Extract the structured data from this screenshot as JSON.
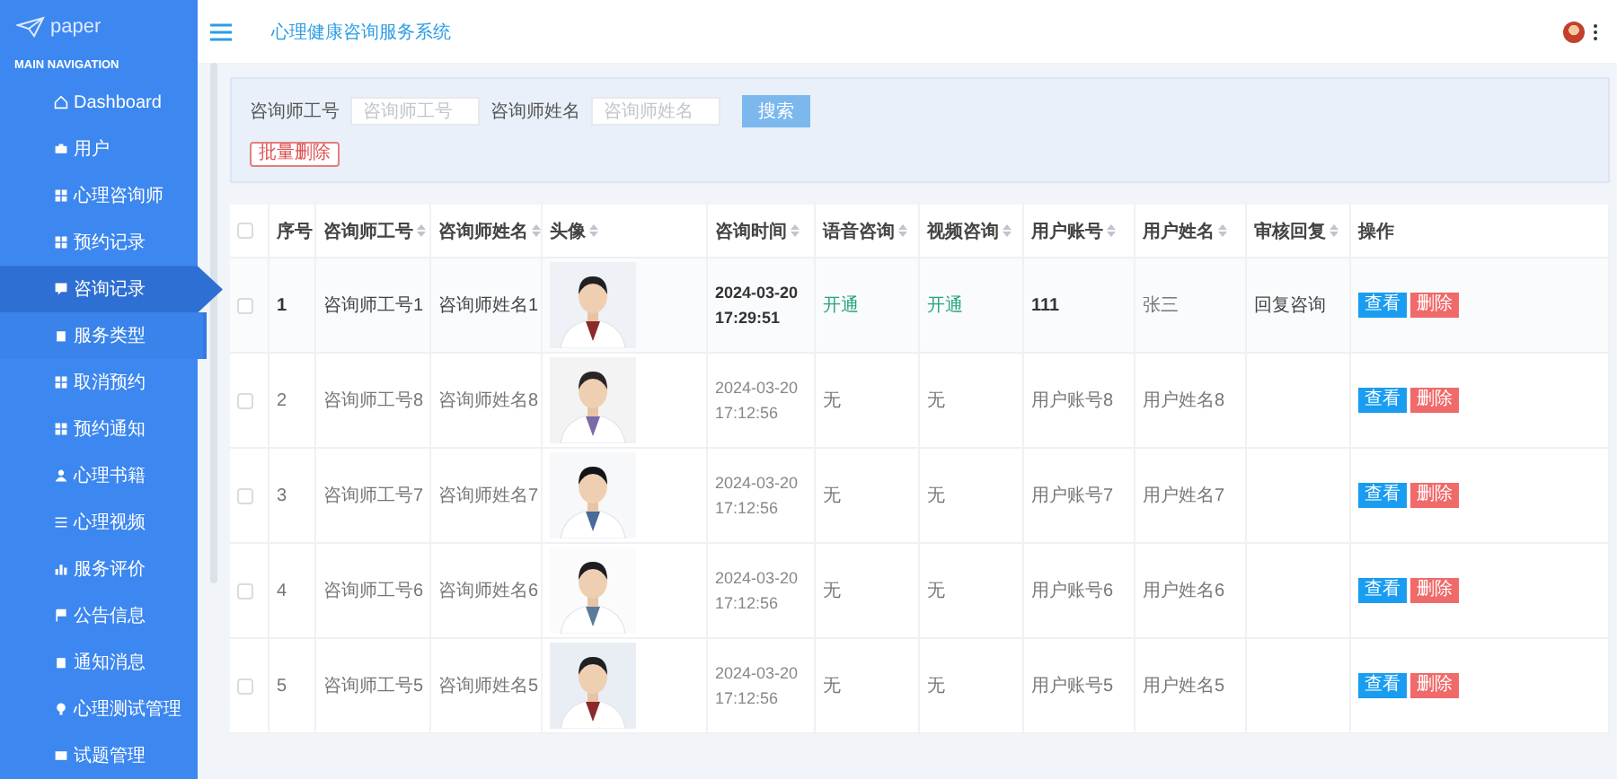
{
  "sidebar": {
    "logo": "paper",
    "section": "MAIN NAVIGATION",
    "items": [
      {
        "label": "Dashboard",
        "selected": false,
        "hovered": false
      },
      {
        "label": "用户",
        "selected": false,
        "hovered": false
      },
      {
        "label": "心理咨询师",
        "selected": false,
        "hovered": false
      },
      {
        "label": "预约记录",
        "selected": false,
        "hovered": false
      },
      {
        "label": "咨询记录",
        "selected": true,
        "hovered": false
      },
      {
        "label": "服务类型",
        "selected": false,
        "hovered": true
      },
      {
        "label": "取消预约",
        "selected": false,
        "hovered": false
      },
      {
        "label": "预约通知",
        "selected": false,
        "hovered": false
      },
      {
        "label": "心理书籍",
        "selected": false,
        "hovered": false
      },
      {
        "label": "心理视频",
        "selected": false,
        "hovered": false
      },
      {
        "label": "服务评价",
        "selected": false,
        "hovered": false
      },
      {
        "label": "公告信息",
        "selected": false,
        "hovered": false
      },
      {
        "label": "通知消息",
        "selected": false,
        "hovered": false
      },
      {
        "label": "心理测试管理",
        "selected": false,
        "hovered": false
      },
      {
        "label": "试题管理",
        "selected": false,
        "hovered": false
      }
    ]
  },
  "header": {
    "title": "心理健康咨询服务系统"
  },
  "search": {
    "fields": [
      {
        "label": "咨询师工号",
        "placeholder": "咨询师工号"
      },
      {
        "label": "咨询师姓名",
        "placeholder": "咨询师姓名"
      }
    ],
    "search_button": "搜索",
    "batch_delete_button": "批量删除"
  },
  "table": {
    "select_all": {
      "checked": false
    },
    "columns": [
      {
        "label": "序号",
        "sortable": false
      },
      {
        "label": "咨询师工号",
        "sortable": true
      },
      {
        "label": "咨询师姓名",
        "sortable": true
      },
      {
        "label": "头像",
        "sortable": true
      },
      {
        "label": "咨询时间",
        "sortable": true
      },
      {
        "label": "语音咨询",
        "sortable": true
      },
      {
        "label": "视频咨询",
        "sortable": true
      },
      {
        "label": "用户账号",
        "sortable": true
      },
      {
        "label": "用户姓名",
        "sortable": true
      },
      {
        "label": "审核回复",
        "sortable": true
      },
      {
        "label": "操作",
        "sortable": false
      }
    ],
    "rows": [
      {
        "checked": false,
        "highlighted": true,
        "index": "1",
        "counselor_id": "咨询师工号1",
        "counselor_name": "咨询师姓名1",
        "time": "2024-03-20 17:29:51",
        "voice": {
          "text": "开通",
          "enabled": true
        },
        "video": {
          "text": "开通",
          "enabled": true
        },
        "user_account": "111",
        "user_name": "张三",
        "reply": "回复咨询",
        "view": "查看",
        "delete": "删除"
      },
      {
        "checked": false,
        "highlighted": false,
        "index": "2",
        "counselor_id": "咨询师工号8",
        "counselor_name": "咨询师姓名8",
        "time": "2024-03-20 17:12:56",
        "voice": {
          "text": "无",
          "enabled": false
        },
        "video": {
          "text": "无",
          "enabled": false
        },
        "user_account": "用户账号8",
        "user_name": "用户姓名8",
        "view": "查看",
        "delete": "删除"
      },
      {
        "checked": false,
        "highlighted": false,
        "index": "3",
        "counselor_id": "咨询师工号7",
        "counselor_name": "咨询师姓名7",
        "time": "2024-03-20 17:12:56",
        "voice": {
          "text": "无",
          "enabled": false
        },
        "video": {
          "text": "无",
          "enabled": false
        },
        "user_account": "用户账号7",
        "user_name": "用户姓名7",
        "view": "查看",
        "delete": "删除"
      },
      {
        "checked": false,
        "highlighted": false,
        "index": "4",
        "counselor_id": "咨询师工号6",
        "counselor_name": "咨询师姓名6",
        "time": "2024-03-20 17:12:56",
        "voice": {
          "text": "无",
          "enabled": false
        },
        "video": {
          "text": "无",
          "enabled": false
        },
        "user_account": "用户账号6",
        "user_name": "用户姓名6",
        "view": "查看",
        "delete": "删除"
      },
      {
        "checked": false,
        "highlighted": false,
        "index": "5",
        "counselor_id": "咨询师工号5",
        "counselor_name": "咨询师姓名5",
        "time": "2024-03-20 17:12:56",
        "voice": {
          "text": "无",
          "enabled": false
        },
        "video": {
          "text": "无",
          "enabled": false
        },
        "user_account": "用户账号5",
        "user_name": "用户姓名5",
        "view": "查看",
        "delete": "删除"
      }
    ]
  }
}
